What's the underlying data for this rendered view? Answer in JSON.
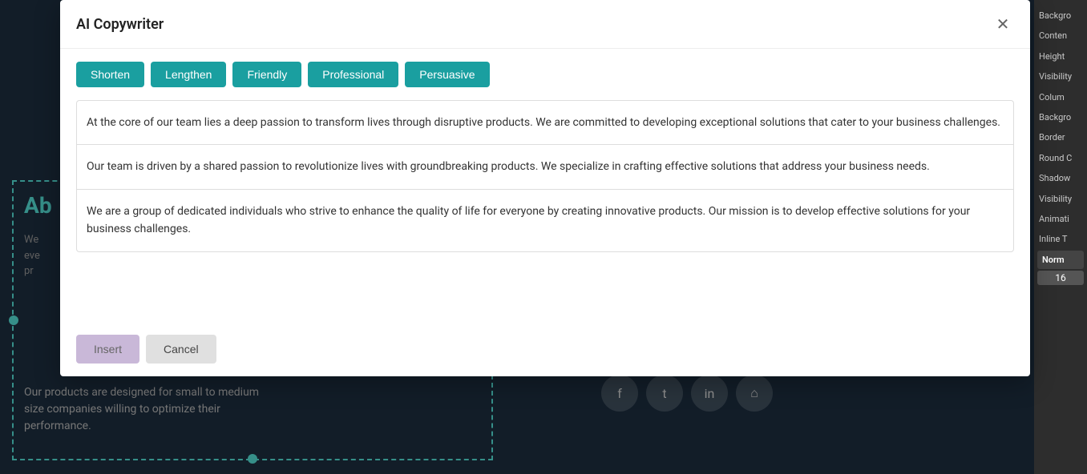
{
  "modal": {
    "title": "AI Copywriter",
    "close_icon": "✕",
    "toolbar": {
      "buttons": [
        {
          "label": "Shorten",
          "id": "shorten"
        },
        {
          "label": "Lengthen",
          "id": "lengthen"
        },
        {
          "label": "Friendly",
          "id": "friendly"
        },
        {
          "label": "Professional",
          "id": "professional"
        },
        {
          "label": "Persuasive",
          "id": "persuasive"
        }
      ]
    },
    "text_options": [
      {
        "id": "option1",
        "text": "At the core of our team lies a deep passion to transform lives through disruptive products. We are committed to developing exceptional solutions that cater to your business challenges."
      },
      {
        "id": "option2",
        "text": "Our team is driven by a shared passion to revolutionize lives with groundbreaking products. We specialize in crafting effective solutions that address your business needs."
      },
      {
        "id": "option3",
        "text": "We are a group of dedicated individuals who strive to enhance the quality of life for everyone by creating innovative products. Our mission is to develop effective solutions for your business challenges."
      }
    ],
    "footer": {
      "insert_label": "Insert",
      "cancel_label": "Cancel"
    }
  },
  "sidebar": {
    "items": [
      {
        "label": "Backgro",
        "id": "background"
      },
      {
        "label": "Conten",
        "id": "content"
      },
      {
        "label": "Height",
        "id": "height"
      },
      {
        "label": "Visibility",
        "id": "visibility"
      },
      {
        "label": "Colum",
        "id": "column"
      },
      {
        "label": "Backgro",
        "id": "bg2"
      },
      {
        "label": "Border",
        "id": "border"
      },
      {
        "label": "Round C",
        "id": "round"
      },
      {
        "label": "Shadow",
        "id": "shadow"
      },
      {
        "label": "Visibility",
        "id": "visibility2"
      },
      {
        "label": "Animati",
        "id": "animation"
      },
      {
        "label": "Inline T",
        "id": "inline"
      },
      {
        "label": "Norm",
        "id": "norm",
        "bold": true
      },
      {
        "label": "16",
        "id": "number",
        "number": true
      }
    ]
  },
  "preview": {
    "about_text": "Ab",
    "body_text": "We\neve\npr",
    "description": "Our products are designed for small to medium size companies willing to optimize their performance.",
    "social_icons": [
      "f",
      "t",
      "in",
      "⌂"
    ]
  },
  "colors": {
    "teal": "#1a9fa0",
    "insert_bg": "#c9b8d8",
    "sidebar_bg": "#2d2d2d"
  }
}
